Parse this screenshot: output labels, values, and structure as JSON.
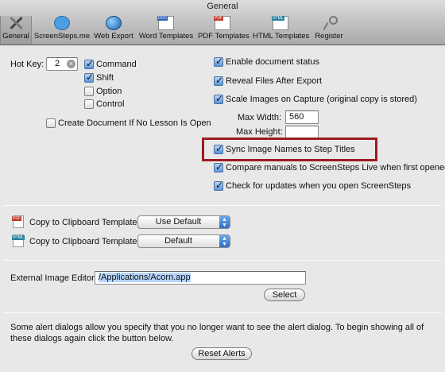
{
  "window": {
    "title": "General"
  },
  "toolbar": {
    "items": [
      {
        "label": "General",
        "icon": "general-icon",
        "selected": true
      },
      {
        "label": "ScreenSteps.me",
        "icon": "speech-bubble-icon"
      },
      {
        "label": "Web Export",
        "icon": "globe-icon"
      },
      {
        "label": "Word Templates",
        "icon": "word-document-icon"
      },
      {
        "label": "PDF Templates",
        "icon": "pdf-document-icon"
      },
      {
        "label": "HTML Templates",
        "icon": "html-document-icon"
      },
      {
        "label": "Register",
        "icon": "key-icon"
      }
    ]
  },
  "hotkey": {
    "label": "Hot Key:",
    "value": "2",
    "modifiers": [
      {
        "label": "Command",
        "checked": true
      },
      {
        "label": "Shift",
        "checked": true
      },
      {
        "label": "Option",
        "checked": false
      },
      {
        "label": "Control",
        "checked": false
      }
    ]
  },
  "create_doc": {
    "label": "Create Document If No Lesson Is Open",
    "checked": false
  },
  "options": {
    "enable_status": {
      "label": "Enable document status",
      "checked": true
    },
    "reveal_files": {
      "label": "Reveal Files After Export",
      "checked": true
    },
    "scale_images": {
      "label": "Scale Images on Capture (original copy is stored)",
      "checked": true
    },
    "max_width": {
      "label": "Max Width:",
      "value": "560"
    },
    "max_height": {
      "label": "Max Height:",
      "value": ""
    },
    "sync_names": {
      "label": "Sync Image Names to Step Titles",
      "checked": true
    },
    "compare_manuals": {
      "label": "Compare manuals to ScreenSteps Live when first opened",
      "checked": true
    },
    "check_updates": {
      "label": "Check for updates when you open ScreenSteps",
      "checked": true
    }
  },
  "clipboard": {
    "pdf": {
      "label": "Copy to Clipboard Template:",
      "value": "Use Default",
      "icon": "pdf-document-icon"
    },
    "html": {
      "label": "Copy to Clipboard Template:",
      "value": "Default",
      "icon": "html-document-icon"
    }
  },
  "editor": {
    "label": "External Image Editor:",
    "value": "/Applications/Acorn.app",
    "select_label": "Select"
  },
  "alerts": {
    "text": "Some alert dialogs allow you specify that you no longer want to see the alert dialog. To begin showing all of these dialogs again click the button below.",
    "reset_label": "Reset Alerts"
  },
  "colors": {
    "highlight_border": "#9b1b1f",
    "accent": "#2f6fc4"
  }
}
